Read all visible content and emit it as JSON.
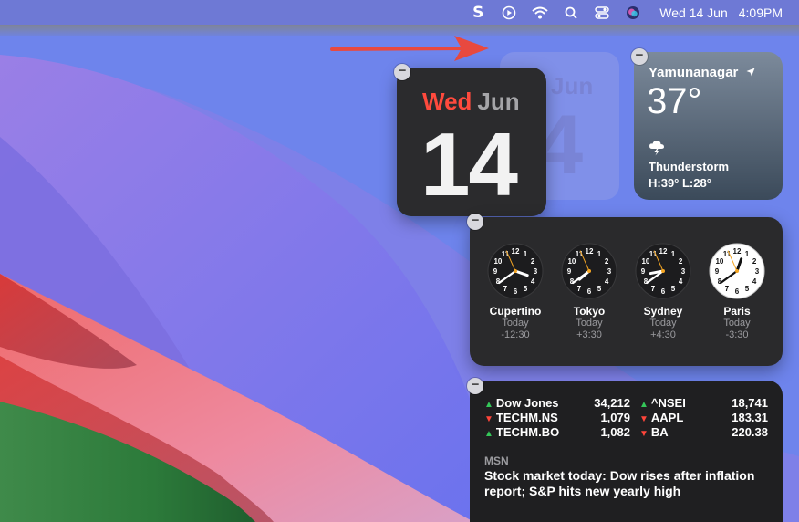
{
  "menubar": {
    "icons": [
      "scrivener-s-icon",
      "play-circle-icon",
      "wifi-icon",
      "search-icon",
      "control-center-icon",
      "siri-icon"
    ],
    "s_glyph": "S",
    "date": "Wed 14 Jun",
    "time": "4:09PM"
  },
  "calendar": {
    "weekday": "Wed",
    "month": "Jun",
    "day": "14",
    "ghost_month": "Jun",
    "ghost_day": "4"
  },
  "weather": {
    "city": "Yamunanagar",
    "temperature": "37°",
    "condition": "Thunderstorm",
    "high_low": "H:39° L:28°"
  },
  "world_clock": {
    "cities": [
      {
        "city": "Cupertino",
        "day": "Today",
        "offset": "-12:30",
        "hour": 3,
        "minute": 39,
        "second": 56,
        "face": "dark"
      },
      {
        "city": "Tokyo",
        "day": "Today",
        "offset": "+3:30",
        "hour": 7,
        "minute": 39,
        "second": 56,
        "face": "dark"
      },
      {
        "city": "Sydney",
        "day": "Today",
        "offset": "+4:30",
        "hour": 8,
        "minute": 39,
        "second": 56,
        "face": "dark"
      },
      {
        "city": "Paris",
        "day": "Today",
        "offset": "-3:30",
        "hour": 12,
        "minute": 39,
        "second": 56,
        "face": "light"
      }
    ]
  },
  "stocks": {
    "left": [
      {
        "symbol": "Dow Jones",
        "value": "34,212",
        "direction": "up"
      },
      {
        "symbol": "TECHM.NS",
        "value": "1,079",
        "direction": "down"
      },
      {
        "symbol": "TECHM.BO",
        "value": "1,082",
        "direction": "up"
      }
    ],
    "right": [
      {
        "symbol": "^NSEI",
        "value": "18,741",
        "direction": "up"
      },
      {
        "symbol": "AAPL",
        "value": "183.31",
        "direction": "down"
      },
      {
        "symbol": "BA",
        "value": "220.38",
        "direction": "down"
      }
    ],
    "news_source": "MSN",
    "news_headline": "Stock market today: Dow rises after inflation report; S&P hits new yearly high"
  },
  "colors": {
    "arrow": "#e8493f",
    "up": "#34c759",
    "down": "#ff453a",
    "calendar_weekday": "#ff4a3d"
  },
  "remove_glyph": "−"
}
